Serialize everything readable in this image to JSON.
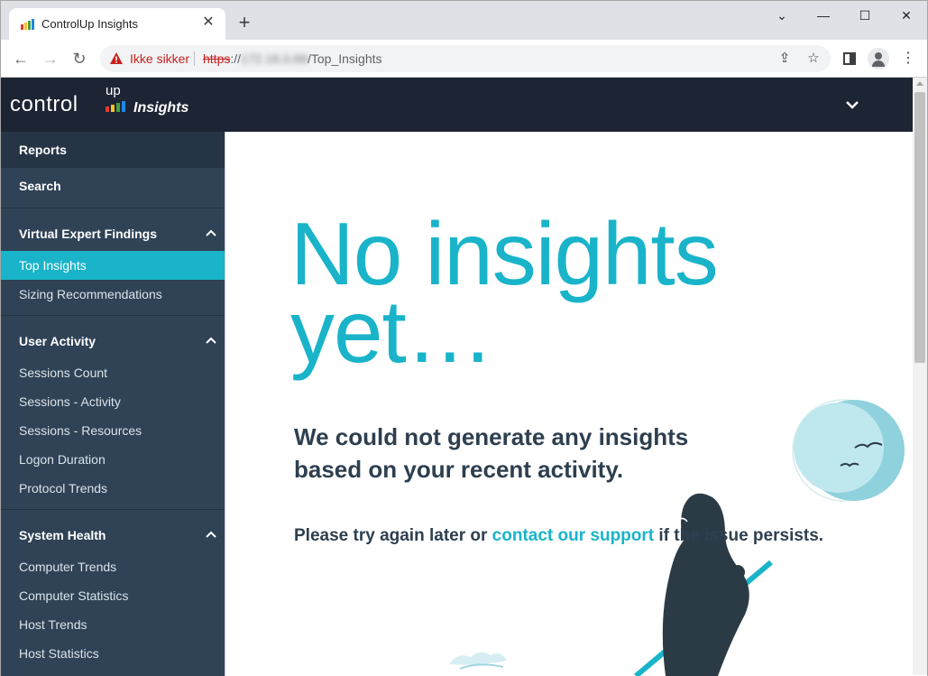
{
  "browser": {
    "tab_title": "ControlUp Insights",
    "tab_close": "✕",
    "new_tab": "+",
    "window": {
      "minimize": "—",
      "maximize": "☐",
      "close": "✕",
      "dropdown": "⌄"
    },
    "nav": {
      "back": "←",
      "forward": "→",
      "reload": "↻"
    },
    "not_secure": "Ikke sikker",
    "url_scheme": "https",
    "url_sep": "://",
    "url_host": "172.16.0.68",
    "url_path": "/Top_Insights"
  },
  "header": {
    "logo_text": "control",
    "logo_up": "up",
    "logo_insights": "Insights"
  },
  "sidebar": {
    "reports": "Reports",
    "search": "Search",
    "sections": [
      {
        "title": "Virtual Expert Findings",
        "items": [
          "Top Insights",
          "Sizing Recommendations"
        ]
      },
      {
        "title": "User Activity",
        "items": [
          "Sessions Count",
          "Sessions - Activity",
          "Sessions - Resources",
          "Logon Duration",
          "Protocol Trends"
        ]
      },
      {
        "title": "System Health",
        "items": [
          "Computer Trends",
          "Computer Statistics",
          "Host Trends",
          "Host Statistics"
        ]
      }
    ],
    "active_item": "Top Insights"
  },
  "main": {
    "headline_line1": "No insights",
    "headline_line2": "yet…",
    "subhead_line1": "We could not generate any insights",
    "subhead_line2": "based on your recent activity.",
    "try_prefix": "Please try again later or ",
    "try_link": "contact our support",
    "try_suffix": " if the issue persists."
  },
  "colors": {
    "accent": "#19b4c9",
    "sidebar_bg": "#2f4256",
    "header_bg": "#1d2433",
    "text_dark": "#2e3f4f"
  }
}
